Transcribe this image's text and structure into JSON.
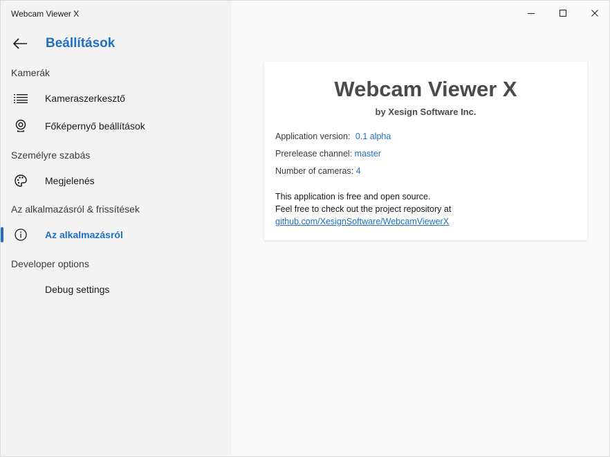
{
  "window": {
    "title": "Webcam Viewer X"
  },
  "sidebar": {
    "header": "Beállítások",
    "sections": [
      {
        "title": "Kamerák",
        "items": [
          {
            "label": "Kameraszerkesztő",
            "icon": "list-icon"
          },
          {
            "label": "Főképernyő beállítások",
            "icon": "webcam-icon"
          }
        ]
      },
      {
        "title": "Személyre szabás",
        "items": [
          {
            "label": "Megjelenés",
            "icon": "palette-icon"
          }
        ]
      },
      {
        "title": "Az alkalmazásról & frissítések",
        "items": [
          {
            "label": "Az alkalmazásról",
            "icon": "info-icon",
            "active": true
          }
        ]
      },
      {
        "title": "Developer options",
        "items": [
          {
            "label": "Debug settings",
            "icon": ""
          }
        ]
      }
    ]
  },
  "about": {
    "title": "Webcam Viewer X",
    "subtitle": "by Xesign Software Inc.",
    "version_label": "Application version:",
    "version_value": "0.1 alpha",
    "channel_label": "Prerelease channel:",
    "channel_value": "master",
    "cameras_label": "Number of cameras:",
    "cameras_value": "4",
    "desc_line1": "This application is free and open source.",
    "desc_line2": "Feel free to check out the project repository at",
    "repo_link": "github.com/XesignSoftware/WebcamViewerX"
  },
  "colors": {
    "accent": "#1f6fc5",
    "sidebar_bg": "#f3f3f3",
    "content_bg": "#fafafa"
  }
}
